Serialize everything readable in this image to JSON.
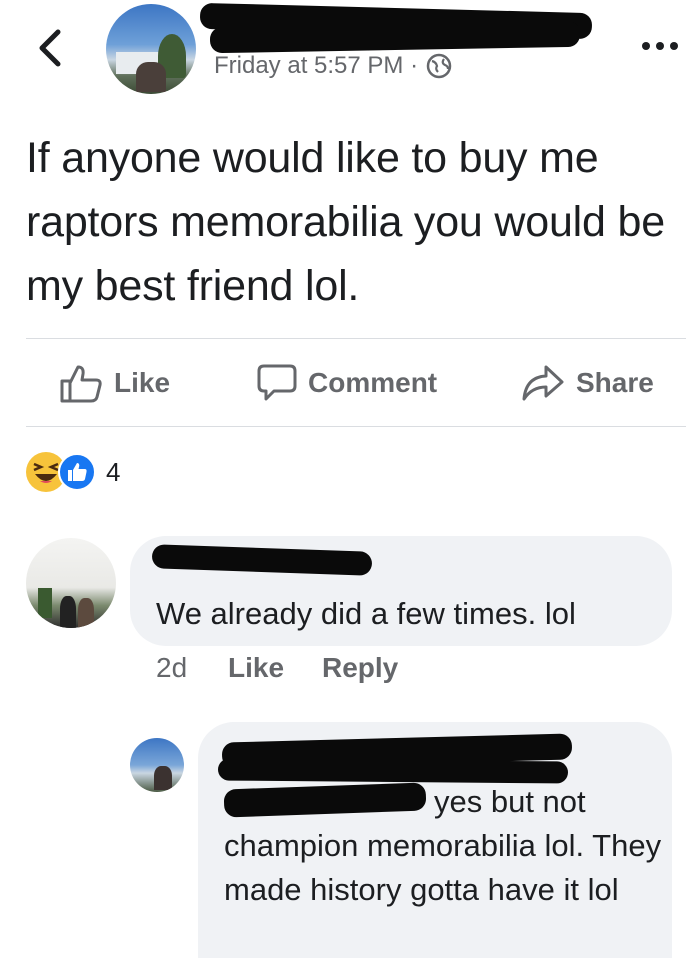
{
  "header": {
    "timestamp": "Friday at 5:57 PM ·"
  },
  "post": {
    "text": "If anyone would like to buy me raptors memorabilia you would be my best friend lol."
  },
  "actions": {
    "like": "Like",
    "comment": "Comment",
    "share": "Share"
  },
  "reactions": {
    "count": "4"
  },
  "comments": [
    {
      "text": "We already did a few times. lol",
      "age": "2d",
      "like": "Like",
      "reply": "Reply"
    },
    {
      "text_line1": "yes but not",
      "text_rest": "champion memorabilia lol. They made history gotta have it lol"
    }
  ],
  "colors": {
    "accent": "#1877f2",
    "muted": "#65676b",
    "bubble": "#f0f2f5"
  }
}
